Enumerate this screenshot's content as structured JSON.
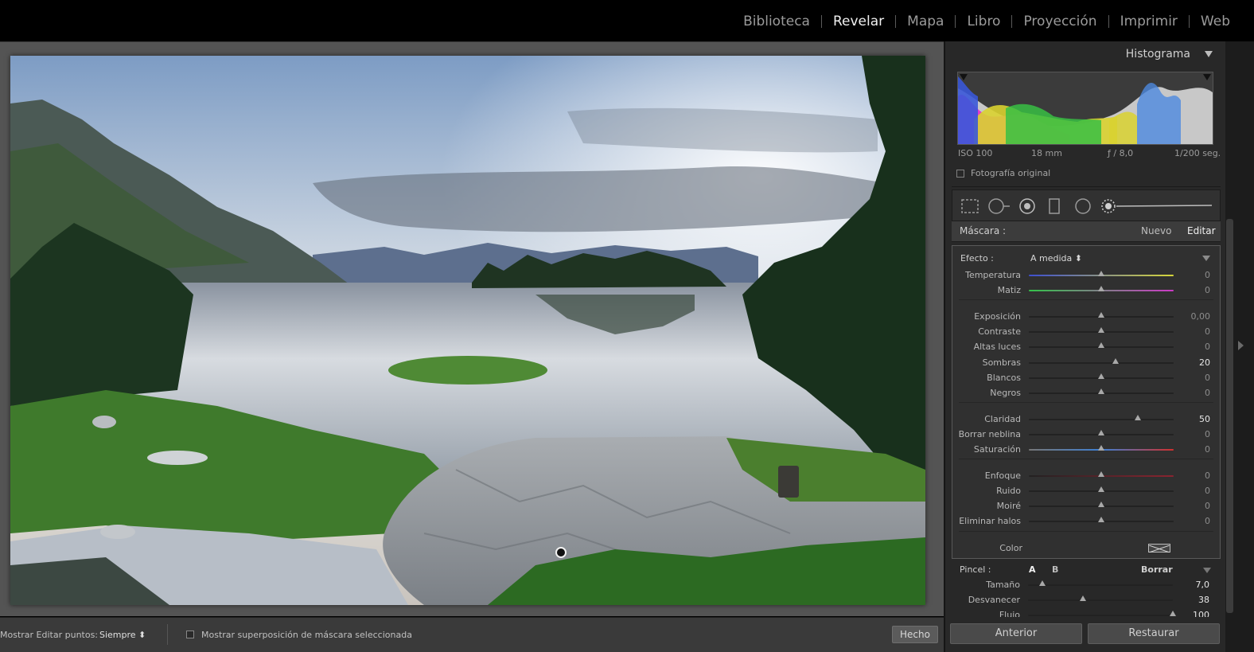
{
  "modules": {
    "items": [
      {
        "label": "Biblioteca",
        "active": false
      },
      {
        "label": "Revelar",
        "active": true
      },
      {
        "label": "Mapa",
        "active": false
      },
      {
        "label": "Libro",
        "active": false
      },
      {
        "label": "Proyección",
        "active": false
      },
      {
        "label": "Imprimir",
        "active": false
      },
      {
        "label": "Web",
        "active": false
      }
    ]
  },
  "histogram": {
    "title": "Histograma",
    "iso": "ISO 100",
    "focal": "18 mm",
    "aperture": "ƒ / 8,0",
    "shutter": "1/200 seg.",
    "original_label": "Fotografía original"
  },
  "mask": {
    "label": "Máscara :",
    "new_label": "Nuevo",
    "edit_label": "Editar"
  },
  "effect": {
    "label": "Efecto :",
    "value": "A medida ⬍",
    "sliders": [
      {
        "label": "Temperatura",
        "value": "0",
        "fraction": 0.5,
        "set": false
      },
      {
        "label": "Matiz",
        "value": "0",
        "fraction": 0.5,
        "set": false
      },
      {
        "label": "Exposición",
        "value": "0,00",
        "fraction": 0.5,
        "set": false
      },
      {
        "label": "Contraste",
        "value": "0",
        "fraction": 0.5,
        "set": false
      },
      {
        "label": "Altas luces",
        "value": "0",
        "fraction": 0.5,
        "set": false
      },
      {
        "label": "Sombras",
        "value": "20",
        "fraction": 0.6,
        "set": true
      },
      {
        "label": "Blancos",
        "value": "0",
        "fraction": 0.5,
        "set": false
      },
      {
        "label": "Negros",
        "value": "0",
        "fraction": 0.5,
        "set": false
      },
      {
        "label": "Claridad",
        "value": "50",
        "fraction": 0.75,
        "set": true
      },
      {
        "label": "Borrar neblina",
        "value": "0",
        "fraction": 0.5,
        "set": false
      },
      {
        "label": "Saturación",
        "value": "0",
        "fraction": 0.5,
        "set": false
      },
      {
        "label": "Enfoque",
        "value": "0",
        "fraction": 0.5,
        "set": false
      },
      {
        "label": "Ruido",
        "value": "0",
        "fraction": 0.5,
        "set": false
      },
      {
        "label": "Moiré",
        "value": "0",
        "fraction": 0.5,
        "set": false
      },
      {
        "label": "Eliminar halos",
        "value": "0",
        "fraction": 0.5,
        "set": false
      }
    ],
    "color_label": "Color"
  },
  "brush": {
    "label": "Pincel :",
    "a_label": "A",
    "b_label": "B",
    "erase_label": "Borrar",
    "sliders": [
      {
        "label": "Tamaño",
        "value": "7,0",
        "fraction": 0.1
      },
      {
        "label": "Desvanecer",
        "value": "38",
        "fraction": 0.38
      },
      {
        "label": "Flujo",
        "value": "100",
        "fraction": 1.0
      }
    ]
  },
  "toolbar": {
    "show_label": "Mostrar Editar puntos:",
    "show_value": "Siempre ⬍",
    "overlay_label": "Mostrar superposición de máscara seleccionada",
    "done_label": "Hecho"
  },
  "buttons": {
    "previous_label": "Anterior",
    "reset_label": "Restaurar"
  },
  "colors": {
    "panel_bg": "#282828",
    "canvas_bg": "#545454",
    "active_module": "#f0f0f0"
  }
}
